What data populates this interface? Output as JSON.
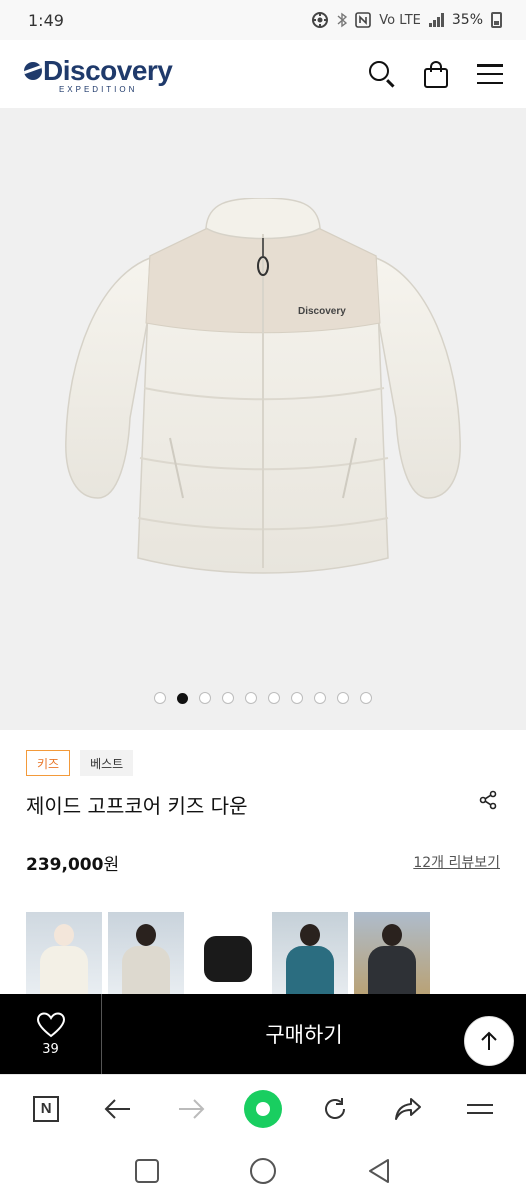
{
  "status_bar": {
    "time": "1:49",
    "carrier": "Vo LTE",
    "battery": "35%",
    "icons": [
      "location-icon",
      "bluetooth-icon",
      "nfc-icon",
      "volte-icon",
      "signal-icon",
      "battery-icon"
    ]
  },
  "header": {
    "logo_main": "Discovery",
    "logo_sub": "EXPEDITION",
    "icons": [
      "search-icon",
      "shopping-bag-icon",
      "hamburger-menu-icon"
    ]
  },
  "gallery": {
    "image_count": 10,
    "active_index": 1,
    "jacket_print": "Discovery"
  },
  "product": {
    "badges": [
      "키즈",
      "베스트"
    ],
    "title": "제이드 고프코어 키즈 다운",
    "price": "239,000",
    "currency": "원",
    "review_link": "12개 리뷰보기"
  },
  "thumbnails": [
    {
      "name": "ivory-model",
      "selected": true
    },
    {
      "name": "beige-model",
      "selected": false
    },
    {
      "name": "black-jacket",
      "selected": false
    },
    {
      "name": "teal-model",
      "selected": false
    },
    {
      "name": "charcoal-model",
      "selected": false
    }
  ],
  "action_bar": {
    "wish_count": "39",
    "buy_label": "구매하기"
  },
  "colors": {
    "brand_navy": "#1f3a6b",
    "badge_orange": "#e8772a",
    "naver_green": "#19ce60",
    "action_black": "#000000"
  }
}
